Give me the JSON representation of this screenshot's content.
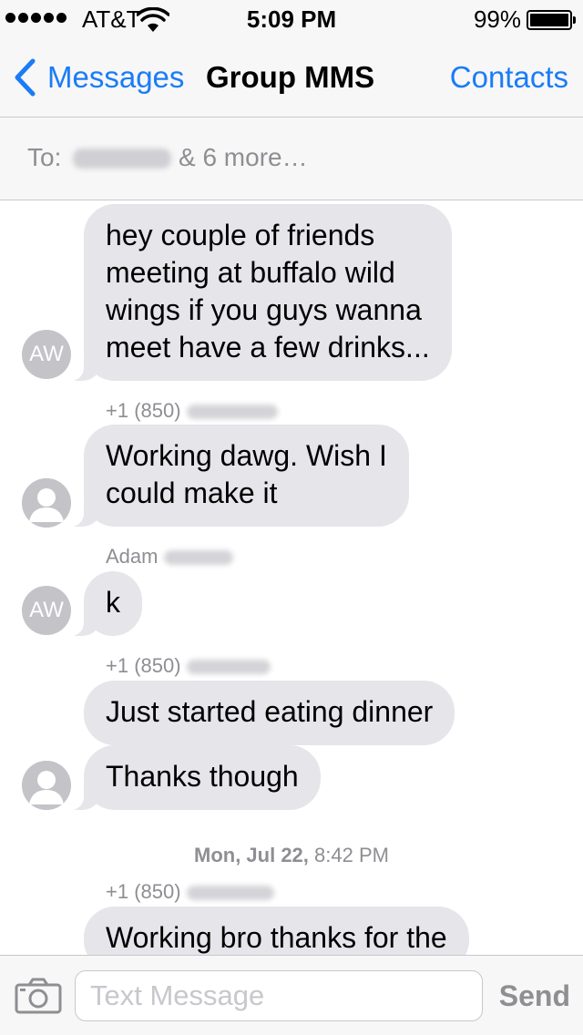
{
  "status_bar": {
    "carrier": "AT&T",
    "time": "5:09 PM",
    "battery": "99%",
    "signal_bars": 5,
    "icons": [
      "signal-dots-icon",
      "wifi-icon",
      "battery-icon"
    ]
  },
  "nav": {
    "back_label": "Messages",
    "title": "Group MMS",
    "right_label": "Contacts",
    "accent_color": "#1a7cf7"
  },
  "recipients": {
    "to_label": "To:",
    "more_text": "& 6 more…"
  },
  "messages": [
    {
      "avatar": "AW",
      "lines": [
        "hey couple of friends",
        "meeting at buffalo wild",
        "wings if you guys wanna",
        "meet have a few drinks..."
      ]
    },
    {
      "sender": "+1 (850)",
      "avatar": "person-silhouette-icon",
      "text": "Working dawg. Wish I could make it",
      "lines": [
        "Working dawg. Wish I",
        "could make it"
      ]
    },
    {
      "sender": "Adam",
      "avatar": "AW",
      "text": "k"
    },
    {
      "sender": "+1 (850)",
      "text": "Just started eating dinner"
    },
    {
      "avatar": "person-silhouette-icon",
      "text": "Thanks though"
    },
    {
      "sender": "+1 (850)",
      "text": "Working bro thanks for the"
    }
  ],
  "date_separator": {
    "day": "Mon, Jul 22,",
    "time": "8:42 PM"
  },
  "composer": {
    "placeholder": "Text Message",
    "send_label": "Send",
    "bubble_color": "#e5e5ea"
  }
}
